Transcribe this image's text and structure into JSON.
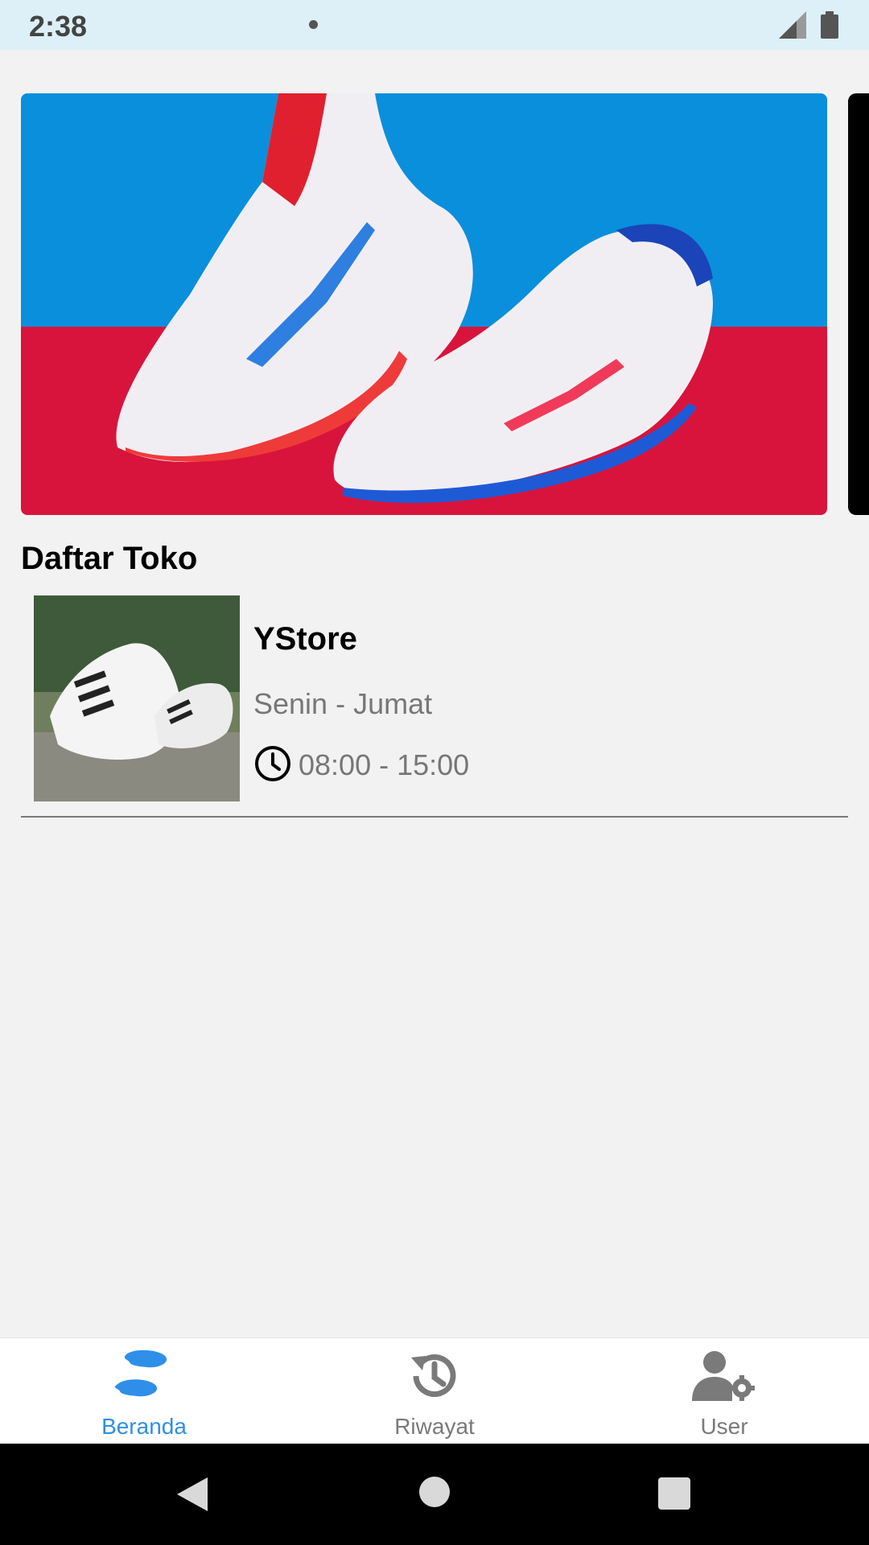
{
  "status_bar": {
    "time": "2:38"
  },
  "section_title": "Daftar Toko",
  "stores": [
    {
      "name": "YStore",
      "days": "Senin - Jumat",
      "hours": "08:00 - 15:00"
    }
  ],
  "bottom_nav": {
    "items": [
      {
        "label": "Beranda",
        "icon": "footsteps-icon",
        "active": true
      },
      {
        "label": "Riwayat",
        "icon": "history-icon",
        "active": false
      },
      {
        "label": "User",
        "icon": "user-settings-icon",
        "active": false
      }
    ]
  },
  "colors": {
    "accent": "#2f8fe8",
    "inactive": "#7a7a7a",
    "background": "#f2f2f2"
  }
}
